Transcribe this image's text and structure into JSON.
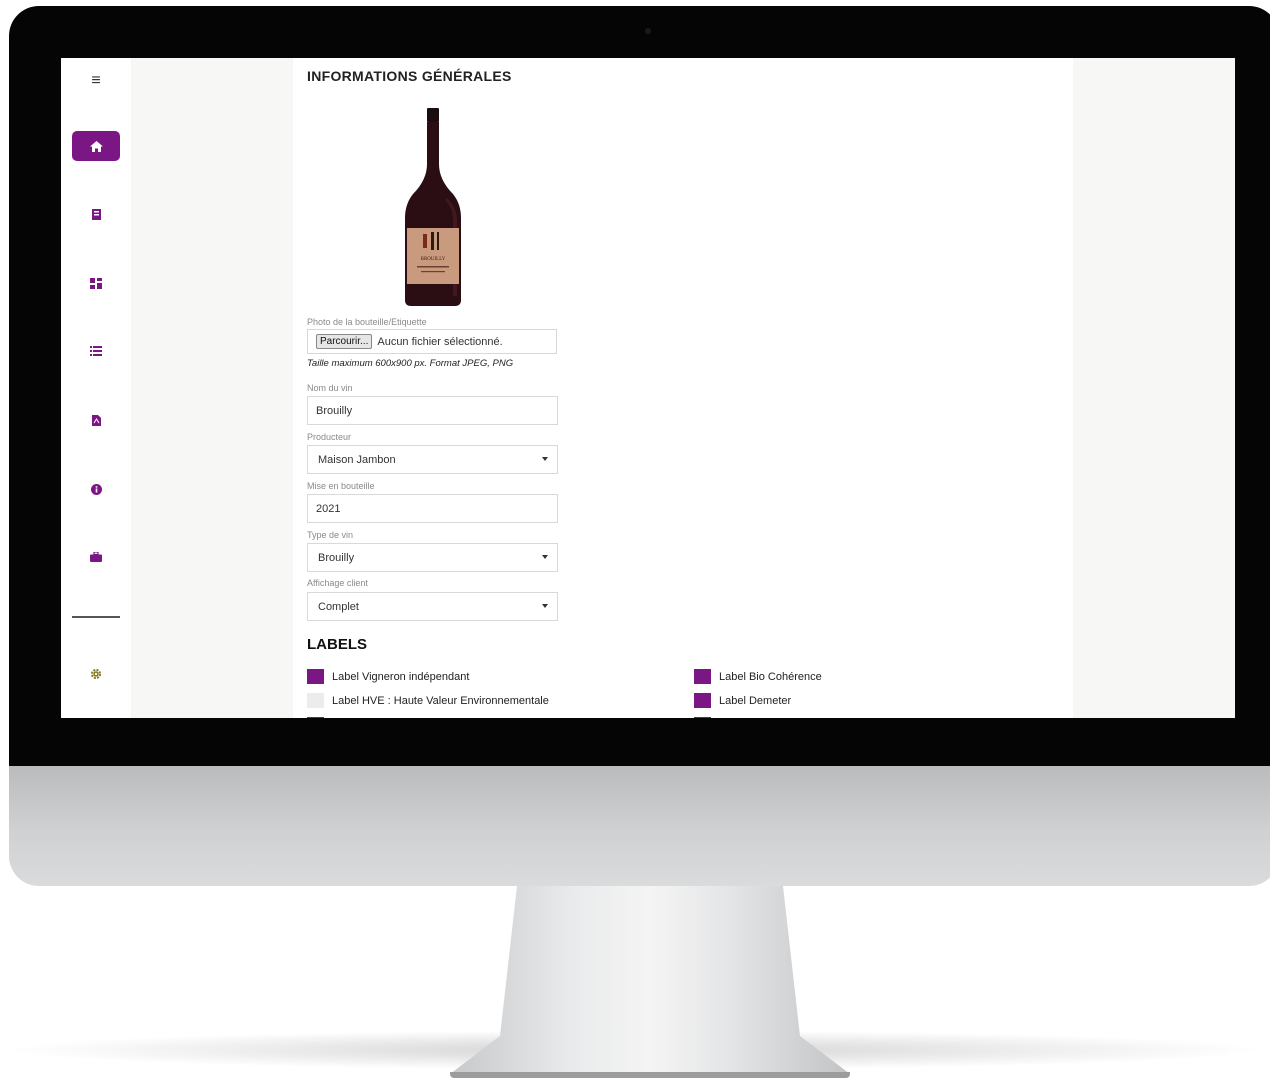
{
  "sidebar": {
    "items": [
      {
        "icon": "menu-icon"
      },
      {
        "icon": "home-icon",
        "active": true
      },
      {
        "icon": "book-icon"
      },
      {
        "icon": "dashboard-icon"
      },
      {
        "icon": "list-icon"
      },
      {
        "icon": "pdf-icon"
      },
      {
        "icon": "info-icon"
      },
      {
        "icon": "briefcase-icon"
      },
      {
        "icon": "gear-icon"
      }
    ]
  },
  "colors": {
    "accent": "#7b1685"
  },
  "main": {
    "title": "INFORMATIONS GÉNÉRALES",
    "bottle_label_text": "BROUILLY",
    "photo": {
      "label": "Photo de la bouteille/Etiquette",
      "browse_label": "Parcourir...",
      "file_status": "Aucun fichier sélectionné.",
      "hint": "Taille maximum 600x900 px. Format JPEG, PNG"
    },
    "wine_name": {
      "label": "Nom du vin",
      "value": "Brouilly"
    },
    "producer": {
      "label": "Producteur",
      "value": "Maison Jambon"
    },
    "bottling": {
      "label": "Mise en bouteille",
      "value": "2021"
    },
    "wine_type": {
      "label": "Type de vin",
      "value": "Brouilly"
    },
    "client_display": {
      "label": "Affichage client",
      "value": "Complet"
    },
    "labels_section": {
      "title": "LABELS",
      "items": [
        {
          "label": "Label Vigneron indépendant",
          "checked": true
        },
        {
          "label": "Label Bio Cohérence",
          "checked": true
        },
        {
          "label": "Label HVE : Haute Valeur Environnementale",
          "checked": false
        },
        {
          "label": "Label Demeter",
          "checked": true
        }
      ]
    }
  }
}
